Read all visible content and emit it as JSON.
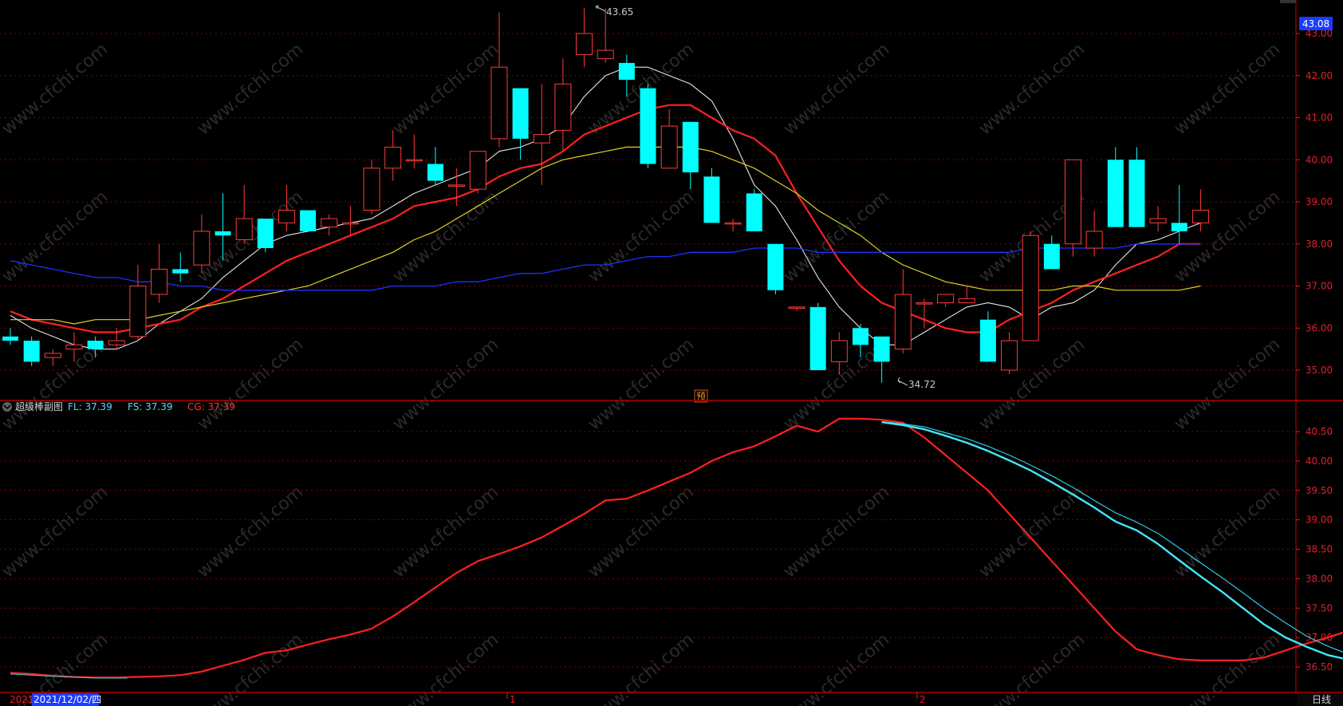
{
  "colors": {
    "background": "#000000",
    "grid": "#8b0000",
    "up_candle": "#ff3b3b",
    "down_candle": "#00ffff",
    "ma5": "#e6e6e6",
    "ma10": "#ff2020",
    "ma20": "#e0d020",
    "ma60": "#2030ff",
    "axis_text": "#e0202a",
    "price_tag_bg": "#1a3cff"
  },
  "price_panel": {
    "current_price_tag": "43.08",
    "high_label": "43.65",
    "low_label": "34.72",
    "marker_label": "预"
  },
  "indicator_panel": {
    "name": "超级棒副图",
    "fl_label": "FL: 37.39",
    "fs_label": "FS: 37.39",
    "cg_label": "CG: 37.39"
  },
  "x_axis": {
    "left_clip": "2021",
    "cursor_date": "2021/12/02/四",
    "month_labels": [
      "1",
      "2"
    ],
    "period_button": "日线"
  },
  "watermark": "www.cfchi.com",
  "chart_data": [
    {
      "type": "candlestick",
      "y_axis_ticks": [
        43.0,
        42.0,
        41.0,
        40.0,
        39.0,
        38.0,
        37.0,
        36.0,
        35.0
      ],
      "ylim": [
        34.35,
        43.55
      ],
      "candles": [
        {
          "o": 35.8,
          "h": 36.0,
          "l": 35.6,
          "c": 35.7
        },
        {
          "o": 35.7,
          "h": 35.8,
          "l": 35.1,
          "c": 35.2
        },
        {
          "o": 35.3,
          "h": 35.5,
          "l": 35.1,
          "c": 35.4
        },
        {
          "o": 35.5,
          "h": 35.9,
          "l": 35.2,
          "c": 35.6
        },
        {
          "o": 35.7,
          "h": 35.8,
          "l": 35.3,
          "c": 35.5
        },
        {
          "o": 35.6,
          "h": 36.0,
          "l": 35.5,
          "c": 35.7
        },
        {
          "o": 35.8,
          "h": 37.5,
          "l": 35.7,
          "c": 37.0
        },
        {
          "o": 36.8,
          "h": 38.0,
          "l": 36.6,
          "c": 37.4
        },
        {
          "o": 37.4,
          "h": 37.8,
          "l": 37.1,
          "c": 37.3
        },
        {
          "o": 37.5,
          "h": 38.7,
          "l": 37.3,
          "c": 38.3
        },
        {
          "o": 38.3,
          "h": 39.2,
          "l": 37.6,
          "c": 38.2
        },
        {
          "o": 38.1,
          "h": 39.4,
          "l": 38.0,
          "c": 38.6
        },
        {
          "o": 38.6,
          "h": 38.6,
          "l": 37.8,
          "c": 37.9
        },
        {
          "o": 38.5,
          "h": 39.4,
          "l": 38.3,
          "c": 38.8
        },
        {
          "o": 38.8,
          "h": 38.8,
          "l": 38.3,
          "c": 38.3
        },
        {
          "o": 38.4,
          "h": 38.7,
          "l": 38.2,
          "c": 38.6
        },
        {
          "o": 38.5,
          "h": 38.9,
          "l": 38.2,
          "c": 38.5
        },
        {
          "o": 38.8,
          "h": 40.0,
          "l": 38.7,
          "c": 39.8
        },
        {
          "o": 39.8,
          "h": 40.7,
          "l": 39.5,
          "c": 40.3
        },
        {
          "o": 40.0,
          "h": 40.6,
          "l": 39.8,
          "c": 40.0
        },
        {
          "o": 39.9,
          "h": 40.3,
          "l": 39.4,
          "c": 39.5
        },
        {
          "o": 39.4,
          "h": 39.8,
          "l": 38.9,
          "c": 39.4
        },
        {
          "o": 39.3,
          "h": 40.2,
          "l": 39.2,
          "c": 40.2
        },
        {
          "o": 40.5,
          "h": 43.5,
          "l": 40.3,
          "c": 42.2
        },
        {
          "o": 41.7,
          "h": 41.7,
          "l": 40.0,
          "c": 40.5
        },
        {
          "o": 40.4,
          "h": 41.8,
          "l": 39.4,
          "c": 40.6
        },
        {
          "o": 40.7,
          "h": 42.4,
          "l": 40.2,
          "c": 41.8
        },
        {
          "o": 42.5,
          "h": 43.6,
          "l": 42.2,
          "c": 43.0
        },
        {
          "o": 42.4,
          "h": 43.6,
          "l": 42.3,
          "c": 42.6
        },
        {
          "o": 42.3,
          "h": 42.5,
          "l": 41.5,
          "c": 41.9
        },
        {
          "o": 41.7,
          "h": 41.8,
          "l": 39.8,
          "c": 39.9
        },
        {
          "o": 39.8,
          "h": 41.2,
          "l": 39.8,
          "c": 40.8
        },
        {
          "o": 40.9,
          "h": 40.9,
          "l": 39.3,
          "c": 39.7
        },
        {
          "o": 39.6,
          "h": 39.8,
          "l": 38.5,
          "c": 38.5
        },
        {
          "o": 38.5,
          "h": 38.6,
          "l": 38.3,
          "c": 38.5
        },
        {
          "o": 39.2,
          "h": 39.3,
          "l": 38.3,
          "c": 38.3
        },
        {
          "o": 38.0,
          "h": 38.0,
          "l": 36.8,
          "c": 36.9
        },
        {
          "o": 36.5,
          "h": 36.5,
          "l": 36.4,
          "c": 36.5
        },
        {
          "o": 36.5,
          "h": 36.6,
          "l": 35.0,
          "c": 35.0
        },
        {
          "o": 35.2,
          "h": 35.9,
          "l": 34.9,
          "c": 35.7
        },
        {
          "o": 36.0,
          "h": 36.1,
          "l": 35.3,
          "c": 35.6
        },
        {
          "o": 35.8,
          "h": 35.8,
          "l": 34.7,
          "c": 35.2
        },
        {
          "o": 35.5,
          "h": 37.4,
          "l": 35.4,
          "c": 36.8
        },
        {
          "o": 36.6,
          "h": 36.7,
          "l": 36.0,
          "c": 36.6
        },
        {
          "o": 36.6,
          "h": 36.8,
          "l": 36.5,
          "c": 36.8
        },
        {
          "o": 36.6,
          "h": 37.0,
          "l": 36.6,
          "c": 36.7
        },
        {
          "o": 36.2,
          "h": 36.4,
          "l": 35.2,
          "c": 35.2
        },
        {
          "o": 35.0,
          "h": 35.9,
          "l": 34.9,
          "c": 35.7
        },
        {
          "o": 35.7,
          "h": 38.3,
          "l": 35.7,
          "c": 38.2
        },
        {
          "o": 38.0,
          "h": 38.2,
          "l": 37.4,
          "c": 37.4
        },
        {
          "o": 38.0,
          "h": 40.0,
          "l": 37.7,
          "c": 40.0
        },
        {
          "o": 37.9,
          "h": 38.8,
          "l": 37.7,
          "c": 38.3
        },
        {
          "o": 40.0,
          "h": 40.3,
          "l": 38.4,
          "c": 38.4
        },
        {
          "o": 40.0,
          "h": 40.3,
          "l": 38.4,
          "c": 38.4
        },
        {
          "o": 38.5,
          "h": 38.9,
          "l": 38.3,
          "c": 38.6
        },
        {
          "o": 38.5,
          "h": 39.4,
          "l": 38.0,
          "c": 38.3
        },
        {
          "o": 38.5,
          "h": 39.3,
          "l": 38.3,
          "c": 38.8
        }
      ],
      "ma_lines": [
        {
          "key": "ma5",
          "values": [
            36.3,
            36.0,
            35.8,
            35.6,
            35.5,
            35.5,
            35.7,
            36.1,
            36.4,
            36.7,
            37.2,
            37.6,
            38.0,
            38.2,
            38.3,
            38.4,
            38.5,
            38.6,
            38.9,
            39.2,
            39.4,
            39.6,
            39.8,
            40.2,
            40.3,
            40.5,
            40.8,
            41.5,
            42.0,
            42.2,
            42.2,
            42.0,
            41.8,
            41.4,
            40.5,
            39.4,
            38.9,
            38.1,
            37.2,
            36.5,
            36.0,
            35.6,
            35.6,
            35.9,
            36.2,
            36.5,
            36.6,
            36.5,
            36.2,
            36.5,
            36.6,
            36.9,
            37.5,
            38.0,
            38.1,
            38.3,
            38.5
          ]
        },
        {
          "key": "ma10",
          "values": [
            36.4,
            36.2,
            36.1,
            36.0,
            35.9,
            35.9,
            36.0,
            36.1,
            36.2,
            36.5,
            36.7,
            37.0,
            37.3,
            37.6,
            37.8,
            38.0,
            38.2,
            38.4,
            38.6,
            38.9,
            39.0,
            39.1,
            39.3,
            39.6,
            39.8,
            39.9,
            40.2,
            40.6,
            40.8,
            41.0,
            41.2,
            41.3,
            41.3,
            41.0,
            40.7,
            40.5,
            40.1,
            39.2,
            38.4,
            37.6,
            37.0,
            36.6,
            36.4,
            36.2,
            36.0,
            35.9,
            35.9,
            36.2,
            36.4,
            36.6,
            36.9,
            37.1,
            37.3,
            37.5,
            37.7,
            38.0,
            38.0
          ]
        },
        {
          "key": "ma20",
          "values": [
            36.2,
            36.2,
            36.2,
            36.1,
            36.2,
            36.2,
            36.2,
            36.3,
            36.4,
            36.5,
            36.6,
            36.7,
            36.8,
            36.9,
            37.0,
            37.2,
            37.4,
            37.6,
            37.8,
            38.1,
            38.3,
            38.6,
            38.9,
            39.2,
            39.5,
            39.8,
            40.0,
            40.1,
            40.2,
            40.3,
            40.3,
            40.3,
            40.3,
            40.2,
            40.0,
            39.8,
            39.5,
            39.2,
            38.8,
            38.5,
            38.2,
            37.8,
            37.5,
            37.3,
            37.1,
            37.0,
            36.9,
            36.9,
            36.9,
            36.9,
            37.0,
            37.0,
            36.9,
            36.9,
            36.9,
            36.9,
            37.0
          ]
        },
        {
          "key": "ma60",
          "values": [
            37.6,
            37.5,
            37.4,
            37.3,
            37.2,
            37.2,
            37.1,
            37.1,
            37.0,
            37.0,
            36.9,
            36.9,
            36.9,
            36.9,
            36.9,
            36.9,
            36.9,
            36.9,
            37.0,
            37.0,
            37.0,
            37.1,
            37.1,
            37.2,
            37.3,
            37.3,
            37.4,
            37.5,
            37.5,
            37.6,
            37.7,
            37.7,
            37.8,
            37.8,
            37.8,
            37.9,
            37.9,
            37.9,
            37.8,
            37.8,
            37.8,
            37.8,
            37.8,
            37.8,
            37.8,
            37.8,
            37.8,
            37.8,
            37.9,
            37.9,
            37.9,
            37.9,
            37.9,
            38.0,
            38.0,
            38.0,
            38.0
          ]
        }
      ]
    },
    {
      "type": "line",
      "title": "超级棒副图",
      "y_axis_ticks": [
        40.5,
        40.0,
        39.5,
        39.0,
        38.5,
        38.0,
        37.5,
        37.0,
        36.5
      ],
      "ylim": [
        36.25,
        40.85
      ],
      "series": [
        {
          "name": "CG",
          "values": [
            36.4,
            36.38,
            36.35,
            36.33,
            36.32,
            36.32,
            36.33,
            36.34,
            36.36,
            36.42,
            36.52,
            36.62,
            36.74,
            36.78,
            36.88,
            36.97,
            37.05,
            37.15,
            37.36,
            37.6,
            37.85,
            38.1,
            38.3,
            38.42,
            38.55,
            38.7,
            38.9,
            39.1,
            39.33,
            39.36,
            39.5,
            39.65,
            39.8,
            40.0,
            40.15,
            40.25,
            40.42,
            40.6,
            40.5,
            40.72,
            40.72,
            40.7,
            40.65,
            40.4,
            40.1,
            39.8,
            39.5,
            39.1,
            38.7,
            38.3,
            37.9,
            37.5,
            37.1,
            36.8,
            36.7,
            36.63,
            36.61,
            36.61,
            36.61,
            36.66,
            36.78,
            36.9,
            37.0,
            37.12,
            37.2,
            37.27,
            37.39
          ]
        },
        {
          "name": "FL",
          "values": [
            null,
            null,
            null,
            null,
            null,
            null,
            null,
            null,
            null,
            null,
            null,
            null,
            null,
            null,
            null,
            null,
            null,
            null,
            null,
            null,
            null,
            null,
            null,
            null,
            null,
            null,
            null,
            null,
            null,
            null,
            null,
            null,
            null,
            null,
            null,
            null,
            null,
            null,
            null,
            null,
            null,
            40.66,
            40.61,
            40.54,
            40.43,
            40.31,
            40.17,
            40.01,
            39.84,
            39.64,
            39.43,
            39.21,
            38.97,
            38.82,
            38.59,
            38.31,
            38.04,
            37.78,
            37.5,
            37.22,
            37.0,
            36.84,
            36.7,
            36.62,
            36.61,
            null,
            null
          ]
        },
        {
          "name": "FS",
          "values": [
            null,
            null,
            null,
            null,
            null,
            null,
            null,
            null,
            null,
            null,
            null,
            null,
            null,
            null,
            null,
            null,
            null,
            null,
            null,
            null,
            null,
            null,
            null,
            null,
            null,
            null,
            null,
            null,
            null,
            null,
            null,
            null,
            null,
            null,
            null,
            null,
            null,
            null,
            null,
            null,
            null,
            40.67,
            40.63,
            40.58,
            40.48,
            40.38,
            40.25,
            40.1,
            39.93,
            39.75,
            39.55,
            39.33,
            39.12,
            38.96,
            38.77,
            38.52,
            38.27,
            38.02,
            37.76,
            37.49,
            37.25,
            37.02,
            36.85,
            36.71,
            36.61,
            null,
            null
          ]
        }
      ]
    }
  ]
}
